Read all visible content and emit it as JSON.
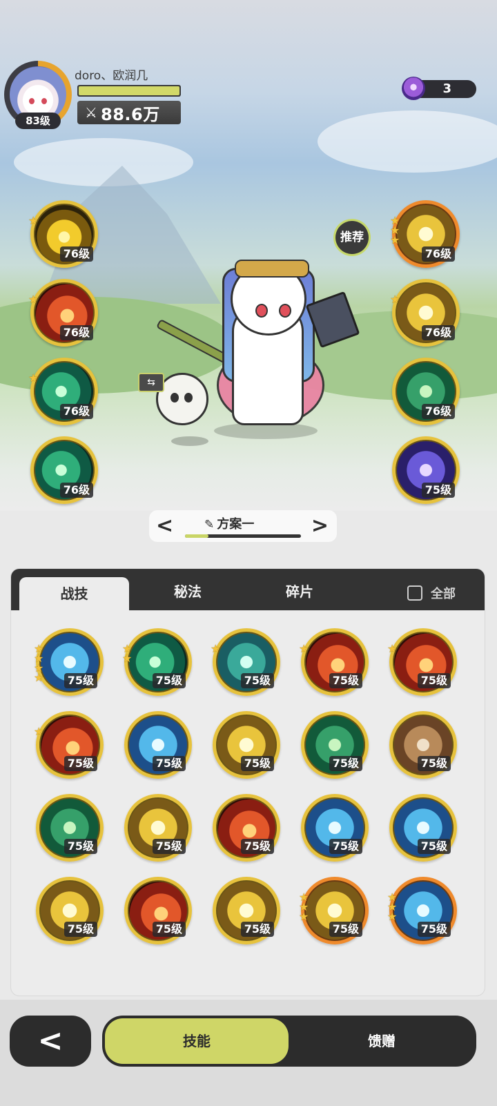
{
  "player": {
    "name": "doro、欧润几",
    "level": "83级",
    "exp_fraction": 1.0,
    "power": "88.6万"
  },
  "currency": {
    "value": "3"
  },
  "recommend_label": "推荐",
  "left_skills": [
    {
      "level": "76级",
      "stars": 1,
      "art": "lightning"
    },
    {
      "level": "76级",
      "stars": 1,
      "art": "fire"
    },
    {
      "level": "76级",
      "stars": 1,
      "art": "wind"
    },
    {
      "level": "76级",
      "stars": 0,
      "art": "wind"
    }
  ],
  "right_skills": [
    {
      "level": "76级",
      "stars": 3,
      "art": "light",
      "rim": "orange"
    },
    {
      "level": "76级",
      "stars": 1,
      "art": "light",
      "rim": "gold"
    },
    {
      "level": "76级",
      "stars": 0,
      "art": "nature",
      "rim": "gold"
    },
    {
      "level": "75级",
      "stars": 0,
      "art": "arcane",
      "rim": "gold"
    }
  ],
  "swap_icon": "⇆",
  "plan": {
    "label": "方案一",
    "prev": "<",
    "next": ">",
    "progress": 0.2
  },
  "tabs": {
    "skill": "战技",
    "secret": "秘法",
    "fragment": "碎片",
    "all": "全部"
  },
  "grid": [
    {
      "level": "75级",
      "stars": 4,
      "art": "ice"
    },
    {
      "level": "75级",
      "stars": 2,
      "art": "wind"
    },
    {
      "level": "75级",
      "stars": 1,
      "art": "water"
    },
    {
      "level": "75级",
      "stars": 1,
      "art": "fire"
    },
    {
      "level": "75级",
      "stars": 1,
      "art": "fire"
    },
    {
      "level": "75级",
      "stars": 1,
      "art": "fire"
    },
    {
      "level": "75级",
      "stars": 0,
      "art": "ice"
    },
    {
      "level": "75级",
      "stars": 0,
      "art": "light"
    },
    {
      "level": "75级",
      "stars": 0,
      "art": "nature"
    },
    {
      "level": "75级",
      "stars": 0,
      "art": "earth"
    },
    {
      "level": "75级",
      "stars": 0,
      "art": "nature"
    },
    {
      "level": "75级",
      "stars": 0,
      "art": "light"
    },
    {
      "level": "75级",
      "stars": 0,
      "art": "fire"
    },
    {
      "level": "75级",
      "stars": 0,
      "art": "ice"
    },
    {
      "level": "75级",
      "stars": 0,
      "art": "ice"
    },
    {
      "level": "75级",
      "stars": 0,
      "art": "light"
    },
    {
      "level": "75级",
      "stars": 0,
      "art": "fire"
    },
    {
      "level": "75级",
      "stars": 0,
      "art": "light"
    },
    {
      "level": "75级",
      "stars": 3,
      "art": "light",
      "rim": "orange"
    },
    {
      "level": "75级",
      "stars": 3,
      "art": "ice",
      "rim": "orange"
    }
  ],
  "bottom": {
    "back": "<",
    "skills": "技能",
    "gift": "馈赠"
  },
  "colors": {
    "accent": "#cfd667",
    "dark": "#2c2c2c",
    "gold": "#e6c23d",
    "orange": "#ef8a2c"
  }
}
